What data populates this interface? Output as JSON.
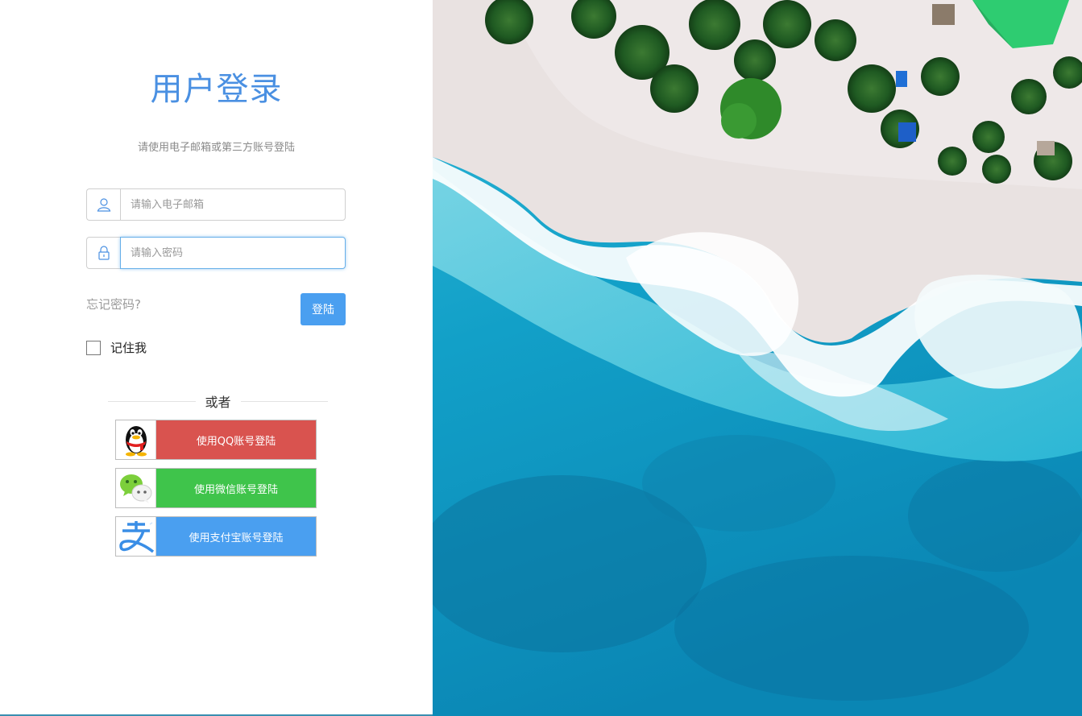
{
  "login": {
    "title": "用户登录",
    "subtitle": "请使用电子邮箱或第三方账号登陆",
    "email_placeholder": "请输入电子邮箱",
    "password_placeholder": "请输入密码",
    "forgot_password": "忘记密码?",
    "login_button": "登陆",
    "remember_me": "记住我",
    "remember_checked": false,
    "divider_text": "或者"
  },
  "social": {
    "qq_label": "使用QQ账号登陆",
    "wechat_label": "使用微信账号登陆",
    "alipay_label": "使用支付宝账号登陆",
    "qq_icon": "qq-penguin-icon",
    "wechat_icon": "wechat-icon",
    "alipay_icon": "alipay-icon"
  },
  "colors": {
    "title": "#4a90e2",
    "login_button": "#4a9ff0",
    "qq": "#d9534f",
    "wechat": "#3fc44b",
    "alipay": "#4a9ff0"
  },
  "hero": {
    "image_subject": "aerial-beach-photo"
  }
}
